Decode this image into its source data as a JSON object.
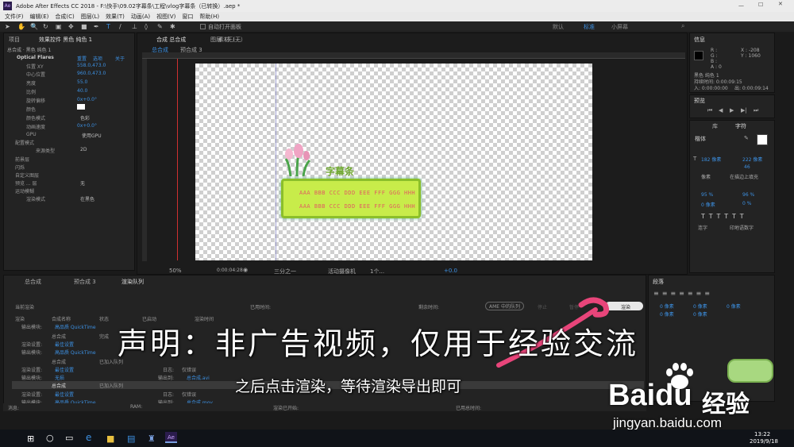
{
  "window": {
    "title": "Adobe After Effects CC 2018 - F:\\快手\\09.02字幕条\\工程\\vlog字幕条（已转换）.aep *"
  },
  "menu": [
    "文件(F)",
    "编辑(E)",
    "合成(C)",
    "图层(L)",
    "效果(T)",
    "动画(A)",
    "视图(V)",
    "窗口",
    "帮助(H)"
  ],
  "toolbar": {
    "auto_open": "自动打开面板",
    "ws_default": "默认",
    "ws_standard": "标准",
    "ws_small": "小屏幕"
  },
  "effects_panel": {
    "tab_project": "项目",
    "tab_effect": "效果控件 黑色 纯色 1",
    "layer_path": "总合成 · 黑色 纯色 1",
    "effect_name": "Optical Flares",
    "reset": "重置",
    "options": "选项",
    "about": "关于",
    "props": [
      {
        "label": "位置 XY",
        "value": "558.0,473.0"
      },
      {
        "label": "中心位置",
        "value": "960.0,473.0"
      },
      {
        "label": "亮度",
        "value": "55.0"
      },
      {
        "label": "比例",
        "value": "40.0"
      },
      {
        "label": "旋转偏移",
        "value": "0x+0.0°"
      },
      {
        "label": "颜色",
        "value": ""
      },
      {
        "label": "颜色模式",
        "value": "色彩"
      },
      {
        "label": "动画速度",
        "value": "0x+0.0°"
      },
      {
        "label": "GPU",
        "value": "使用GPU"
      },
      {
        "label": "配置模式",
        "value": ""
      },
      {
        "label": "来源类型",
        "value": "2D"
      },
      {
        "label": "前景层",
        "value": ""
      },
      {
        "label": "闪烁",
        "value": ""
      },
      {
        "label": "自定义图层",
        "value": ""
      },
      {
        "label": "预览 ... 层",
        "value": "无"
      },
      {
        "label": "运动模糊",
        "value": ""
      },
      {
        "label": "渲染模式",
        "value": "在黑色"
      }
    ]
  },
  "comp_panel": {
    "tab": "合成 总合成",
    "tab_layer": "图层（无）",
    "tab_footage": "素材（无）",
    "breadcrumb_1": "总合成",
    "breadcrumb_2": "预合成 3",
    "zoom": "50%",
    "time": "0:00:04:28",
    "resolution": "三分之一",
    "camera": "活动摄像机",
    "views": "1个...",
    "exposure": "+0.0",
    "subtitle_title": "字幕条",
    "subtitle_line1": "AAA BBB CCC DDD EEE FFF GGG HHH",
    "subtitle_line2": "AAA BBB CCC DDD EEE FFF GGG HHH"
  },
  "info_panel": {
    "tab": "信息",
    "r": "R :",
    "g": "G :",
    "b": "B :",
    "a": "A : 0",
    "x": "X : -208",
    "y": "Y : 1060",
    "layer": "黑色 纯色 1",
    "duration": "持续时间: 0:00:09:15",
    "in_point": "入: 0:00:00:00",
    "out_point": "出: 0:00:09:14"
  },
  "preview_panel": {
    "tab": "预览"
  },
  "char_panel": {
    "tab_lib": "库",
    "tab_char": "字符",
    "font": "楷体",
    "size": "182 像素",
    "leading": "222 像素",
    "tracking": "46",
    "stroke": "像素",
    "stroke_mode": "在描边上填充",
    "vscale": "95 %",
    "hscale": "96 %",
    "baseline": "0 像素",
    "tsume": "0 %",
    "ligature": "连字",
    "hindi": "印地语数字"
  },
  "paragraph_panel": {
    "tab": "段落",
    "indent": "0 像素",
    "indent2": "0 像素",
    "indent3": "0 像素",
    "space": "0 像素",
    "space2": "0 像素"
  },
  "timeline": {
    "tab_comp": "总合成",
    "tab_pre": "预合成 3",
    "tab_render": "渲染队列",
    "current_render": "当前渲染",
    "elapsed": "已用时间:",
    "remaining": "剩余时间:",
    "ame_queue": "AME 中的队列",
    "stop": "停止",
    "pause": "暂停",
    "render": "渲染",
    "col_render": "渲染",
    "col_comp": "合成名称",
    "col_status": "状态",
    "col_started": "已启动",
    "col_rendertime": "渲染时间",
    "rows": [
      {
        "name": "总合成",
        "status": "完成",
        "setting": "最佳设置",
        "module": "高品质  QuickTime",
        "dest": "总合成.mov"
      },
      {
        "name": "总合成",
        "status": "完成",
        "setting": "最佳设置",
        "module": "高品质  QuickTime",
        "dest": "总合成.mov"
      },
      {
        "name": "总合成",
        "status": "已加入队列",
        "setting": "最佳设置",
        "module": "无损",
        "log": "仅错误",
        "dest": "总合成.avi"
      },
      {
        "name": "总合成",
        "status": "已加入队列",
        "setting": "最佳设置",
        "module": "高品质  QuickTime",
        "log": "仅错误",
        "dest": "总合成.mov"
      }
    ],
    "label_render_setting": "渲染设置:",
    "label_output_module": "输出模块:",
    "label_log": "日志:",
    "label_output_to": "输出到:",
    "footer_message": "消息:",
    "footer_ram": "RAM:",
    "footer_started": "渲染已开始:",
    "footer_total": "已用总时间:"
  },
  "captions": {
    "line1": "声明：非广告视频，仅用于经验交流",
    "line2": "之后点击渲染，等待渲染导出即可"
  },
  "watermark": {
    "brand": "Baidu",
    "cn": "经验",
    "url": "jingyan.baidu.com"
  },
  "taskbar": {
    "time": "13:22",
    "date": "2019/9/18"
  },
  "colors": {
    "accent_blue": "#3c8fe0",
    "subtitle_box": "#c8ec4a",
    "ae_purple": "#2b1c4d"
  }
}
